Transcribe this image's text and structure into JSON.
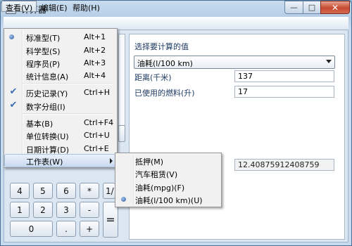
{
  "window": {
    "title": "计算器",
    "controls": {
      "minimize": "—",
      "maximize": "□",
      "close": "✕"
    }
  },
  "menubar": {
    "items": [
      {
        "label": "查看(V)"
      },
      {
        "label": "编辑(E)"
      },
      {
        "label": "帮助(H)"
      }
    ]
  },
  "view_menu": {
    "items": [
      {
        "label": "标准型(T)",
        "shortcut": "Alt+1",
        "state": "radio-selected"
      },
      {
        "label": "科学型(S)",
        "shortcut": "Alt+2"
      },
      {
        "label": "程序员(P)",
        "shortcut": "Alt+3"
      },
      {
        "label": "统计信息(A)",
        "shortcut": "Alt+4"
      },
      {
        "label": "历史记录(Y)",
        "shortcut": "Ctrl+H",
        "state": "checked"
      },
      {
        "label": "数字分组(I)",
        "shortcut": "",
        "state": "checked"
      },
      {
        "label": "基本(B)",
        "shortcut": "Ctrl+F4"
      },
      {
        "label": "单位转换(U)",
        "shortcut": "Ctrl+U"
      },
      {
        "label": "日期计算(D)",
        "shortcut": "Ctrl+E"
      },
      {
        "label": "工作表(W)",
        "shortcut": "",
        "state": "highlighted-submenu"
      }
    ]
  },
  "worksheet_submenu": {
    "items": [
      {
        "label": "抵押(M)"
      },
      {
        "label": "汽车租赁(V)"
      },
      {
        "label": "油耗(mpg)(F)"
      },
      {
        "label": "油耗(l/100 km)(U)",
        "state": "radio-selected"
      }
    ]
  },
  "keypad": {
    "row1": [
      "4",
      "5",
      "6",
      "*",
      "1/"
    ],
    "row2": [
      "1",
      "2",
      "3",
      "-"
    ],
    "row3": [
      "0",
      ".",
      "+"
    ],
    "equals": "="
  },
  "worksheet": {
    "heading": "选择要计算的值",
    "selected_calc": "油耗(l/100 km)",
    "fields": [
      {
        "label": "距离(千米)",
        "value": "137"
      },
      {
        "label": "已使用的燃料(升)",
        "value": "17"
      }
    ],
    "result": "12.40875912408759"
  },
  "icons": {
    "app": "calculator-icon",
    "check": "✔",
    "radio": "radio-dot-icon",
    "submenu_arrow": "chevron-right-icon"
  },
  "colors": {
    "menu_highlight": "#c9daf0",
    "check_blue": "#3c6cb4",
    "close_button": "#c74b32",
    "label_text": "#1e3b64"
  }
}
